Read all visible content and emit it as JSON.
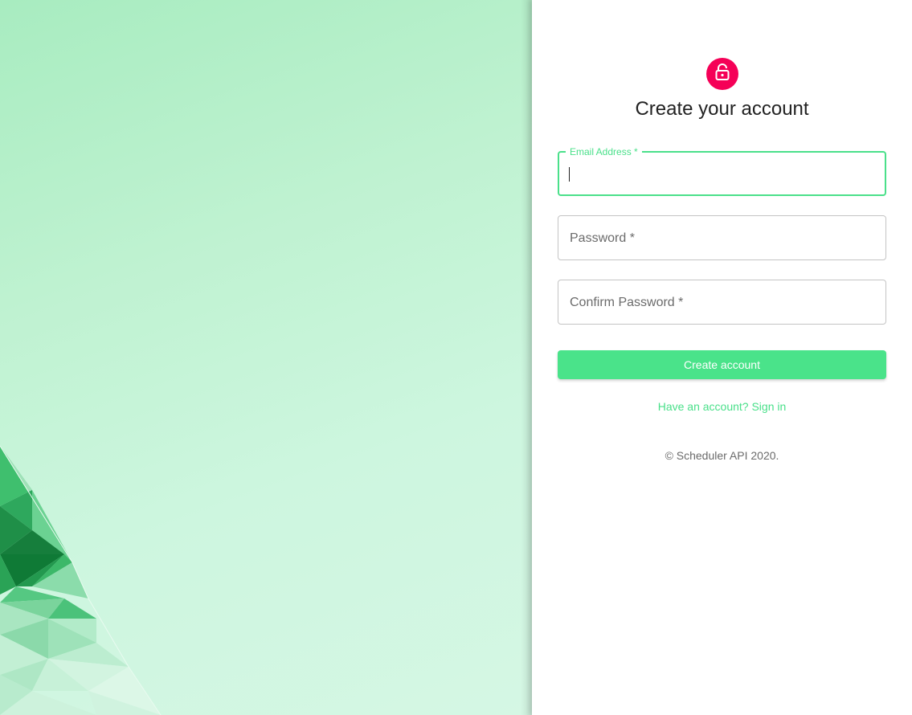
{
  "form": {
    "title": "Create your account",
    "fields": {
      "email": {
        "label": "Email Address *",
        "value": ""
      },
      "password": {
        "label": "Password *",
        "value": ""
      },
      "confirm_password": {
        "label": "Confirm Password *",
        "value": ""
      }
    },
    "submit_label": "Create account",
    "signin_link": "Have an account? Sign in",
    "copyright": "© Scheduler API 2020."
  },
  "icons": {
    "avatar": "lock-icon"
  },
  "colors": {
    "accent": "#4ae08a",
    "avatar_bg": "#f50057",
    "hero_bg": "#c2f3d6"
  }
}
